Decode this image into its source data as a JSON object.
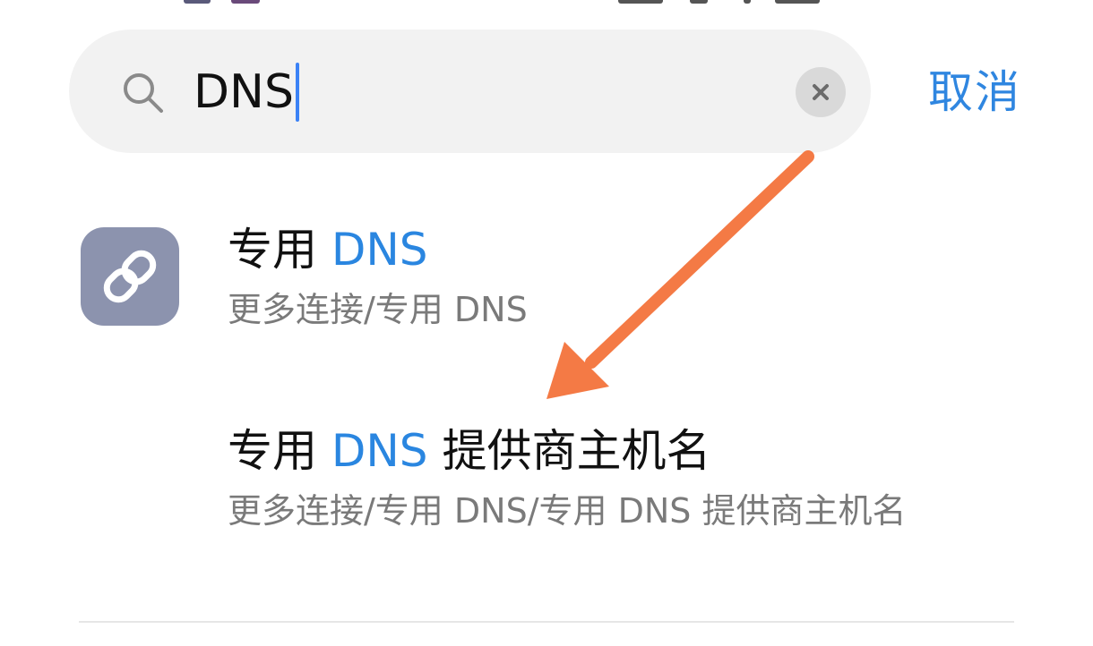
{
  "search": {
    "query": "DNS",
    "cancel_label": "取消"
  },
  "results": [
    {
      "title_prefix": "专用 ",
      "title_highlight": "DNS",
      "title_suffix": "",
      "path": "更多连接/专用 DNS"
    },
    {
      "title_prefix": "专用 ",
      "title_highlight": "DNS",
      "title_suffix": " 提供商主机名",
      "path": "更多连接/专用 DNS/专用 DNS 提供商主机名"
    }
  ],
  "icons": {
    "search": "search-icon",
    "clear": "close-icon",
    "result": "link-icon"
  },
  "colors": {
    "accent": "#2f86e0",
    "highlight": "#2a86e0",
    "annotation_arrow": "#f47a45",
    "icon_bg": "#8c93ae"
  }
}
